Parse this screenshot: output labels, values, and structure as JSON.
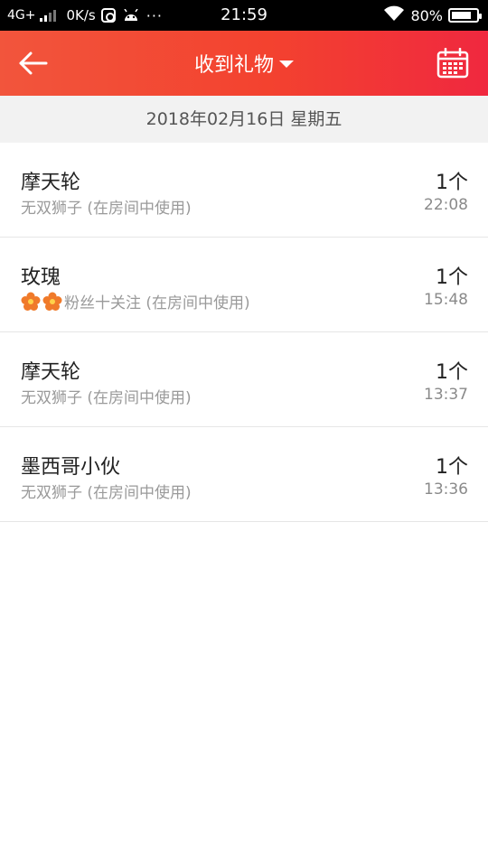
{
  "status_bar": {
    "network": "4G+",
    "speed": "0K/s",
    "time": "21:59",
    "battery": "80%",
    "battery_level": 0.8,
    "more": "···"
  },
  "header": {
    "title": "收到礼物",
    "back_icon": "back-arrow-icon",
    "calendar_icon": "calendar-icon",
    "dropdown_icon": "caret-down-icon"
  },
  "date": "2018年02月16日 星期五",
  "items": [
    {
      "gift": "摩天轮",
      "sender": "无双狮子 (在房间中使用)",
      "quantity": "1个",
      "time": "22:08",
      "badges": 0
    },
    {
      "gift": "玫瑰",
      "sender": "粉丝十关注 (在房间中使用)",
      "quantity": "1个",
      "time": "15:48",
      "badges": 2
    },
    {
      "gift": "摩天轮",
      "sender": "无双狮子 (在房间中使用)",
      "quantity": "1个",
      "time": "13:37",
      "badges": 0
    },
    {
      "gift": "墨西哥小伙",
      "sender": "无双狮子 (在房间中使用)",
      "quantity": "1个",
      "time": "13:36",
      "badges": 0
    }
  ],
  "colors": {
    "header_start": "#f2553c",
    "header_end": "#f0283f",
    "badge_flower": "#f07a2a"
  }
}
